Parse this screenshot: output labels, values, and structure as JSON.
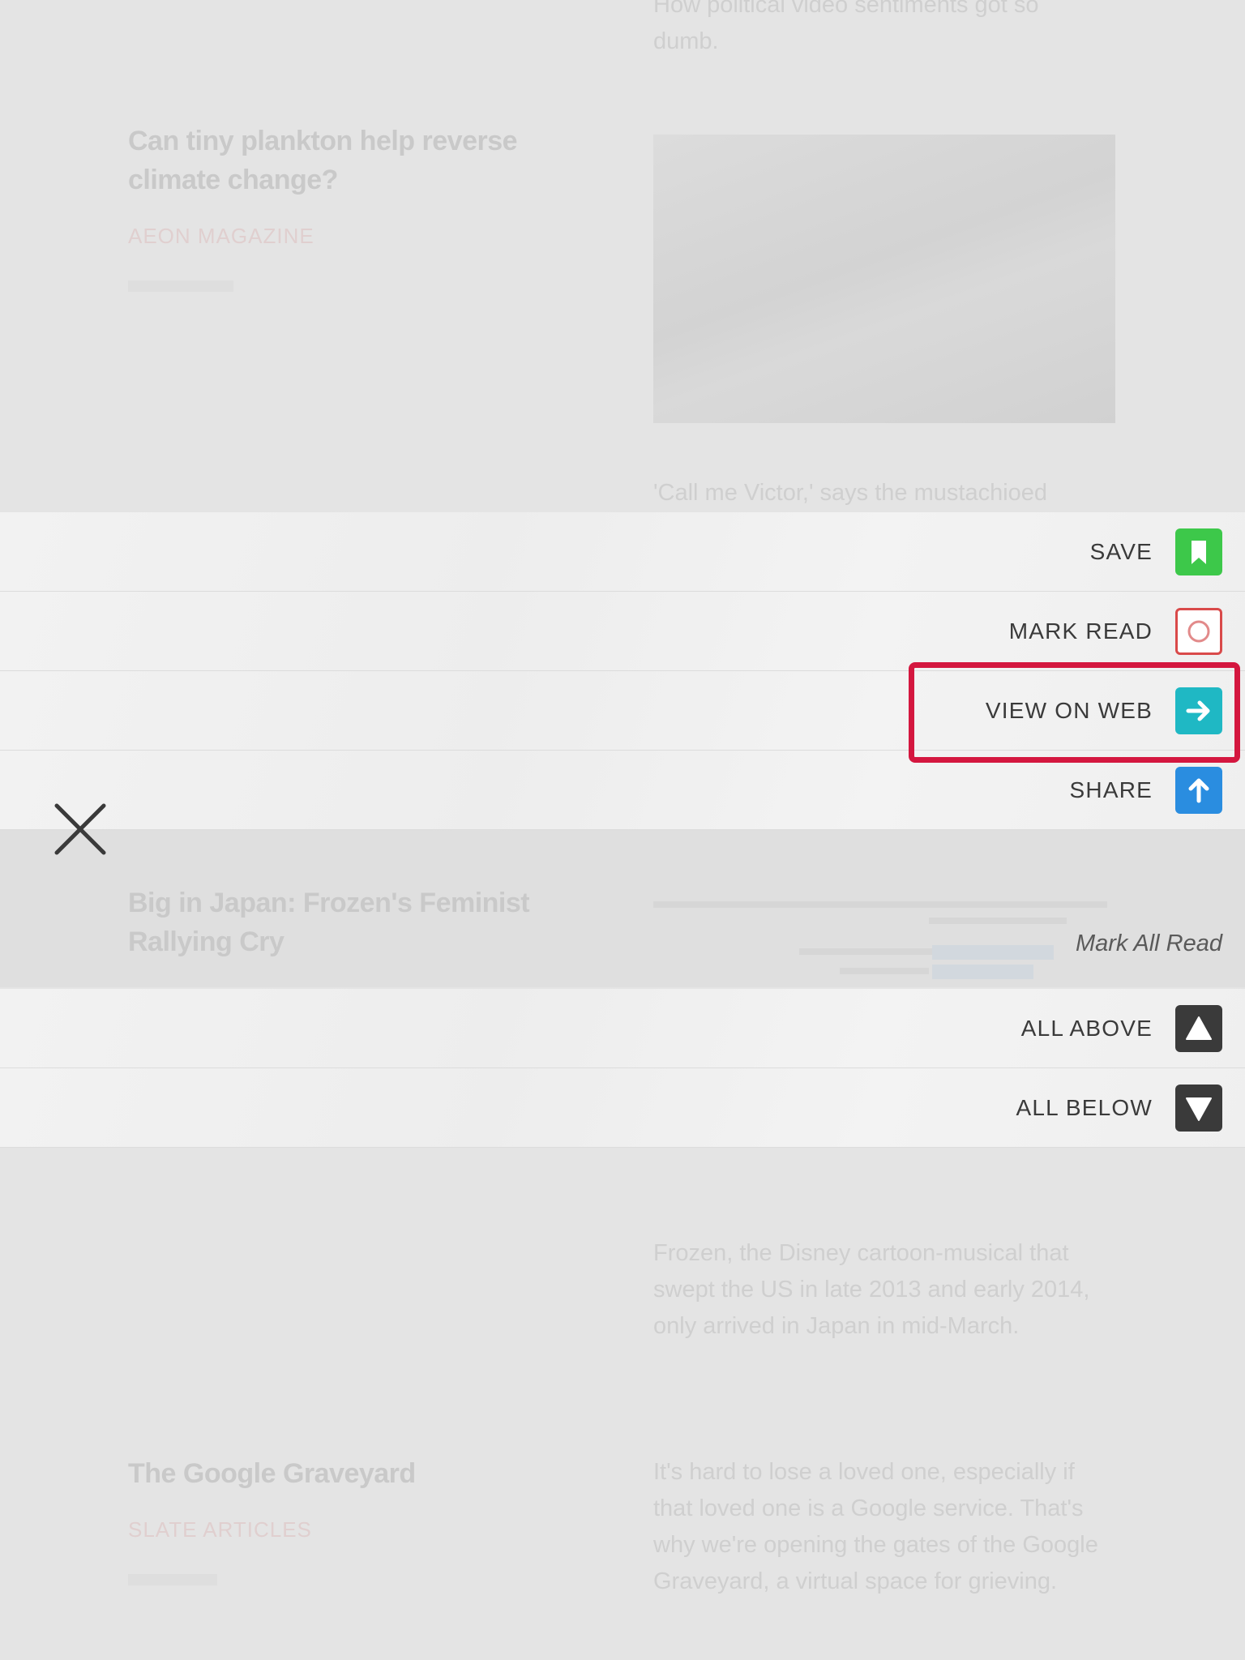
{
  "background": {
    "top_excerpt": "How political video sentiments got so dumb.",
    "articles": [
      {
        "title": "Can tiny plankton help reverse climate change?",
        "source": "AEON MAGAZINE",
        "excerpt": "'Call me Victor,' says the mustachioed"
      },
      {
        "title": "Big in Japan: Frozen's Feminist Rallying Cry",
        "excerpt": "Frozen, the Disney cartoon-musical that swept the US in late 2013 and early 2014, only arrived in Japan in mid-March."
      },
      {
        "title": "The Google Graveyard",
        "source": "SLATE ARTICLES",
        "excerpt": "It's hard to lose a loved one, especially if that loved one is a Google service. That's why we're opening the gates of the Google Graveyard, a virtual space for grieving."
      }
    ]
  },
  "menu": {
    "save": {
      "label": "SAVE",
      "color": "#3dc84a"
    },
    "mark_read": {
      "label": "MARK READ",
      "color": "#d94a4a"
    },
    "view_on_web": {
      "label": "VIEW ON WEB",
      "color": "#1fb8c4"
    },
    "share": {
      "label": "SHARE",
      "color": "#2a8de0"
    }
  },
  "mark_all": {
    "heading": "Mark All Read",
    "all_above": {
      "label": "ALL ABOVE",
      "color": "#3a3a3a"
    },
    "all_below": {
      "label": "ALL BELOW",
      "color": "#3a3a3a"
    }
  },
  "highlight_color": "#d4173f",
  "icons": {
    "close": "close-icon",
    "save": "bookmark-icon",
    "mark_read": "circle-icon",
    "view_on_web": "arrow-right-icon",
    "share": "arrow-up-icon",
    "all_above": "triangle-up-icon",
    "all_below": "triangle-down-icon"
  }
}
